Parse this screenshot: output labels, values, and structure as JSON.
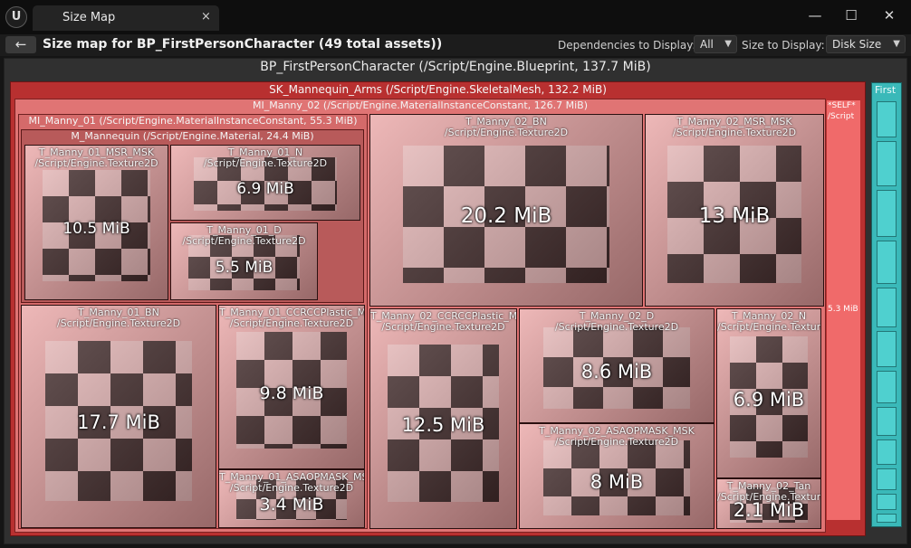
{
  "window": {
    "tab_title": "Size Map",
    "logo": "unreal-logo-icon",
    "tab_close": "×",
    "minimize": "—",
    "maximize": "☐",
    "close": "✕"
  },
  "toolbar": {
    "back_icon": "←",
    "headline": "Size map for BP_FirstPersonCharacter  (49 total assets))",
    "dependencies_label": "Dependencies to Display:",
    "dependencies_value": "All",
    "size_label": "Size to Display:",
    "size_value": "Disk Size"
  },
  "root": {
    "label": "BP_FirstPersonCharacter  (/Script/Engine.Blueprint, 137.7 MiB)"
  },
  "mesh": {
    "label": "SK_Mannequin_Arms  (/Script/Engine.SkeletalMesh, 132.2 MiB)"
  },
  "mi02": {
    "label": "MI_Manny_02  (/Script/Engine.MaterialInstanceConstant, 126.7 MiB)"
  },
  "mi01": {
    "label": "MI_Manny_01  (/Script/Engine.MaterialInstanceConstant, 55.3 MiB)"
  },
  "mannequin": {
    "label": "M_Mannequin  (/Script/Engine.Material, 24.4 MiB)"
  },
  "leaves": [
    {
      "name": "T_Manny_01_MSR_MSK",
      "type": "/Script/Engine.Texture2D",
      "size": "10.5 MiB"
    },
    {
      "name": "T_Manny_01_N",
      "type": "/Script/Engine.Texture2D",
      "size": "6.9 MiB"
    },
    {
      "name": "T_Manny_01_D",
      "type": "/Script/Engine.Texture2D",
      "size": "5.5 MiB"
    },
    {
      "name": "T_Manny_01_BN",
      "type": "/Script/Engine.Texture2D",
      "size": "17.7 MiB"
    },
    {
      "name": "T_Manny_01_CCRCCPlastic_MS",
      "type": "/Script/Engine.Texture2D",
      "size": "9.8 MiB"
    },
    {
      "name": "T_Manny_01_ASAOPMASK_MSI",
      "type": "/Script/Engine.Texture2D",
      "size": "3.4 MiB"
    },
    {
      "name": "T_Manny_02_BN",
      "type": "/Script/Engine.Texture2D",
      "size": "20.2 MiB"
    },
    {
      "name": "T_Manny_02_MSR_MSK",
      "type": "/Script/Engine.Texture2D",
      "size": "13 MiB"
    },
    {
      "name": "T_Manny_02_CCRCCPlastic_MS",
      "type": "/Script/Engine.Texture2D",
      "size": "12.5 MiB"
    },
    {
      "name": "T_Manny_02_D",
      "type": "/Script/Engine.Texture2D",
      "size": "8.6 MiB"
    },
    {
      "name": "T_Manny_02_ASAOPMASK_MSK",
      "type": "/Script/Engine.Texture2D",
      "size": "8 MiB"
    },
    {
      "name": "T_Manny_02_N",
      "type": "/Script/Engine.Texture2D",
      "size": "6.9 MiB"
    },
    {
      "name": "T_Manny_02_Tan",
      "type": "/Script/Engine.Texture2D",
      "size": "2.1 MiB"
    }
  ],
  "self": {
    "label": "*SELF*",
    "type": "/Script",
    "size": "5.3 MiB"
  },
  "first": {
    "label": "First"
  },
  "colors": {
    "root_border": "#b82a2a",
    "mesh": "#b83030",
    "mi02": "#e07474",
    "texture": "#e8a0a0",
    "self": "#f06a6a",
    "teal": "#3ab9b9"
  }
}
